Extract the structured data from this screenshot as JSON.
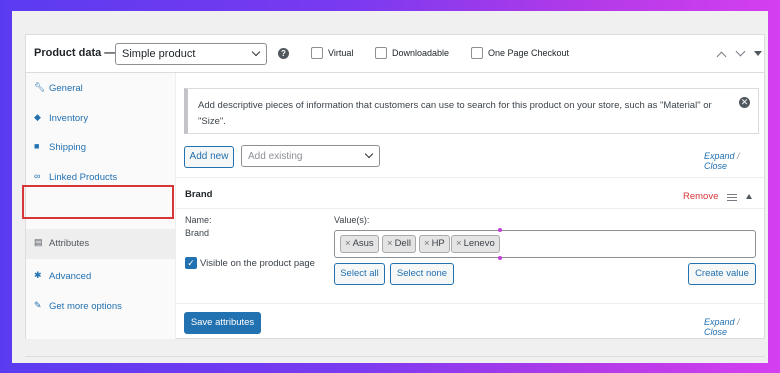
{
  "header": {
    "title": "Product data —",
    "product_type": "Simple product",
    "help_icon": "?",
    "options": [
      {
        "label": "Virtual",
        "checked": false
      },
      {
        "label": "Downloadable",
        "checked": false
      },
      {
        "label": "One Page Checkout",
        "checked": false
      }
    ]
  },
  "sidebar": {
    "items": [
      {
        "label": "General",
        "icon": "wrench-icon"
      },
      {
        "label": "Inventory",
        "icon": "tag-icon"
      },
      {
        "label": "Shipping",
        "icon": "truck-icon"
      },
      {
        "label": "Linked Products",
        "icon": "link-icon"
      },
      {
        "label": "Attributes",
        "icon": "table-icon",
        "active": true
      },
      {
        "label": "Advanced",
        "icon": "gear-icon"
      },
      {
        "label": "Get more options",
        "icon": "plugin-icon"
      }
    ]
  },
  "notice": {
    "text": "Add descriptive pieces of information that customers can use to search for this product on your store, such as \"Material\" or \"Size\".",
    "close": "✕"
  },
  "toolbar": {
    "add_new": "Add new",
    "add_existing_placeholder": "Add existing",
    "expand": "Expand",
    "separator": "/",
    "close": "Close"
  },
  "attribute": {
    "title": "Brand",
    "remove": "Remove",
    "name_label": "Name:",
    "name_value": "Brand",
    "values_label": "Value(s):",
    "values": [
      "Asus",
      "Dell",
      "HP",
      "Lenevo"
    ],
    "visible_label": "Visible on the product page",
    "visible_checked": true,
    "select_all": "Select all",
    "select_none": "Select none",
    "create_value": "Create value"
  },
  "footer": {
    "save": "Save attributes",
    "expand": "Expand",
    "separator": "/",
    "close": "Close"
  },
  "colors": {
    "accent": "#2271b1",
    "remove": "#d63638",
    "highlight_outline": "#d63638"
  }
}
